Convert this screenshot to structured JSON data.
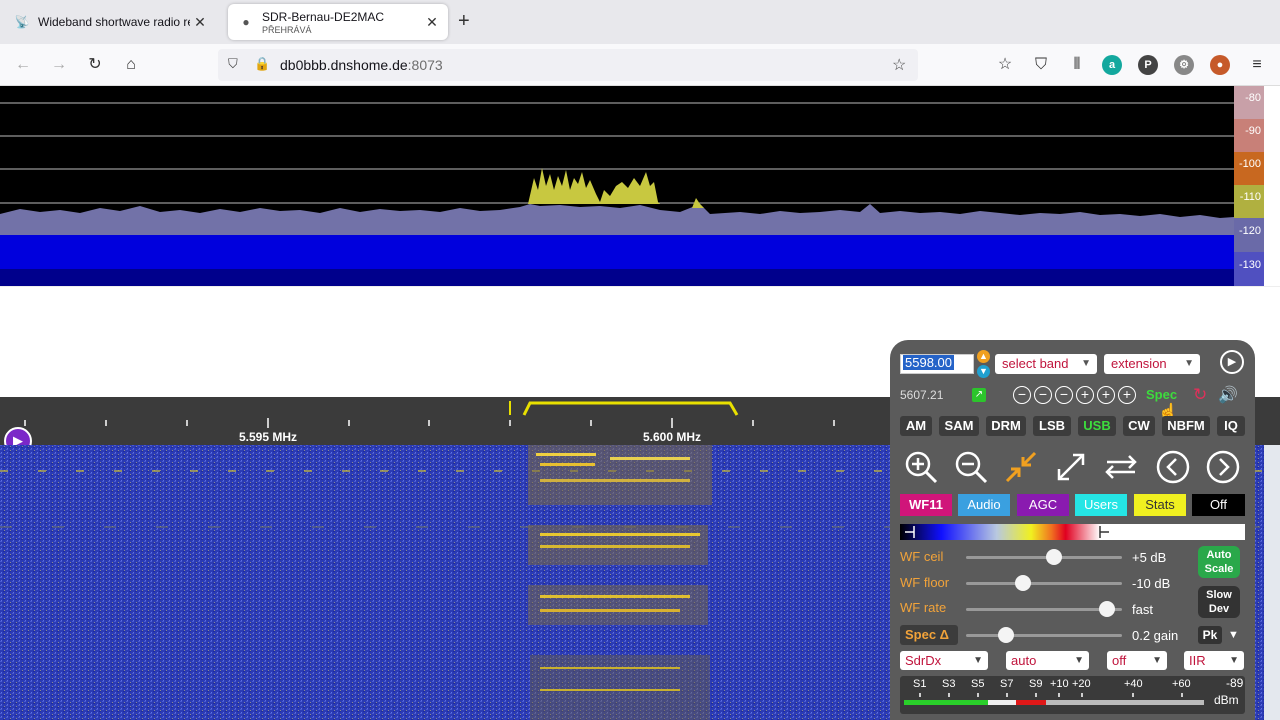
{
  "browser": {
    "tabs": [
      {
        "title": "Wideband shortwave radio rece",
        "subtitle": ""
      },
      {
        "title": "SDR-Bernau-DE2MAC",
        "subtitle": "PŘEHRÁVÁ"
      }
    ],
    "url_host": "db0bbb.dnshome.de",
    "url_port": ":8073",
    "toolbar_icons": [
      "pocket-icon",
      "save-icon",
      "library-icon",
      "a-extension",
      "p-extension",
      "gear-extension",
      "avatar"
    ]
  },
  "spectrum": {
    "db_scale": [
      "-80",
      "-90",
      "-100",
      "-110",
      "-120",
      "-130"
    ],
    "db_colors": [
      "#c8a0a8",
      "#c88078",
      "#c86820",
      "#b0b040",
      "#6a6aa8",
      "#5050c0"
    ]
  },
  "scale": {
    "labels": [
      "5.595 MHz",
      "5.600 MHz"
    ]
  },
  "panel": {
    "freq_selected": "5598.00",
    "select_band": "select band",
    "extension": "extension",
    "prev_freq": "5607.21",
    "spec_label": "Spec",
    "modes": [
      "AM",
      "SAM",
      "DRM",
      "LSB",
      "USB",
      "CW",
      "NBFM",
      "IQ"
    ],
    "active_mode": "USB",
    "tabs": [
      {
        "label": "WF11",
        "bg": "#d0157a",
        "fg": "#ffffff"
      },
      {
        "label": "Audio",
        "bg": "#3aa0e0",
        "fg": "#ffffff"
      },
      {
        "label": "AGC",
        "bg": "#8a1ab0",
        "fg": "#ffffff"
      },
      {
        "label": "Users",
        "bg": "#25e5e5",
        "fg": "#ffffff"
      },
      {
        "label": "Stats",
        "bg": "#f0f020",
        "fg": "#333333"
      },
      {
        "label": "Off",
        "bg": "#000000",
        "fg": "#ffffff"
      }
    ],
    "sliders": [
      {
        "label": "WF ceil",
        "value": "+5 dB",
        "level": 0.57
      },
      {
        "label": "WF floor",
        "value": "-10 dB",
        "level": 0.35
      },
      {
        "label": "WF rate",
        "value": "fast",
        "level": 0.95
      },
      {
        "label": "Spec Δ",
        "value": "0.2 gain",
        "level": 0.23
      }
    ],
    "auto_scale": "Auto Scale",
    "slow_dev": "Slow Dev",
    "pk": "Pk",
    "dropdowns": [
      "SdrDx",
      "auto",
      "off",
      "IIR"
    ],
    "smeter": {
      "labels": [
        "S1",
        "S3",
        "S5",
        "S7",
        "S9",
        "+10",
        "+20",
        "+40",
        "+60"
      ],
      "reading": "-89",
      "unit": "dBm"
    }
  }
}
